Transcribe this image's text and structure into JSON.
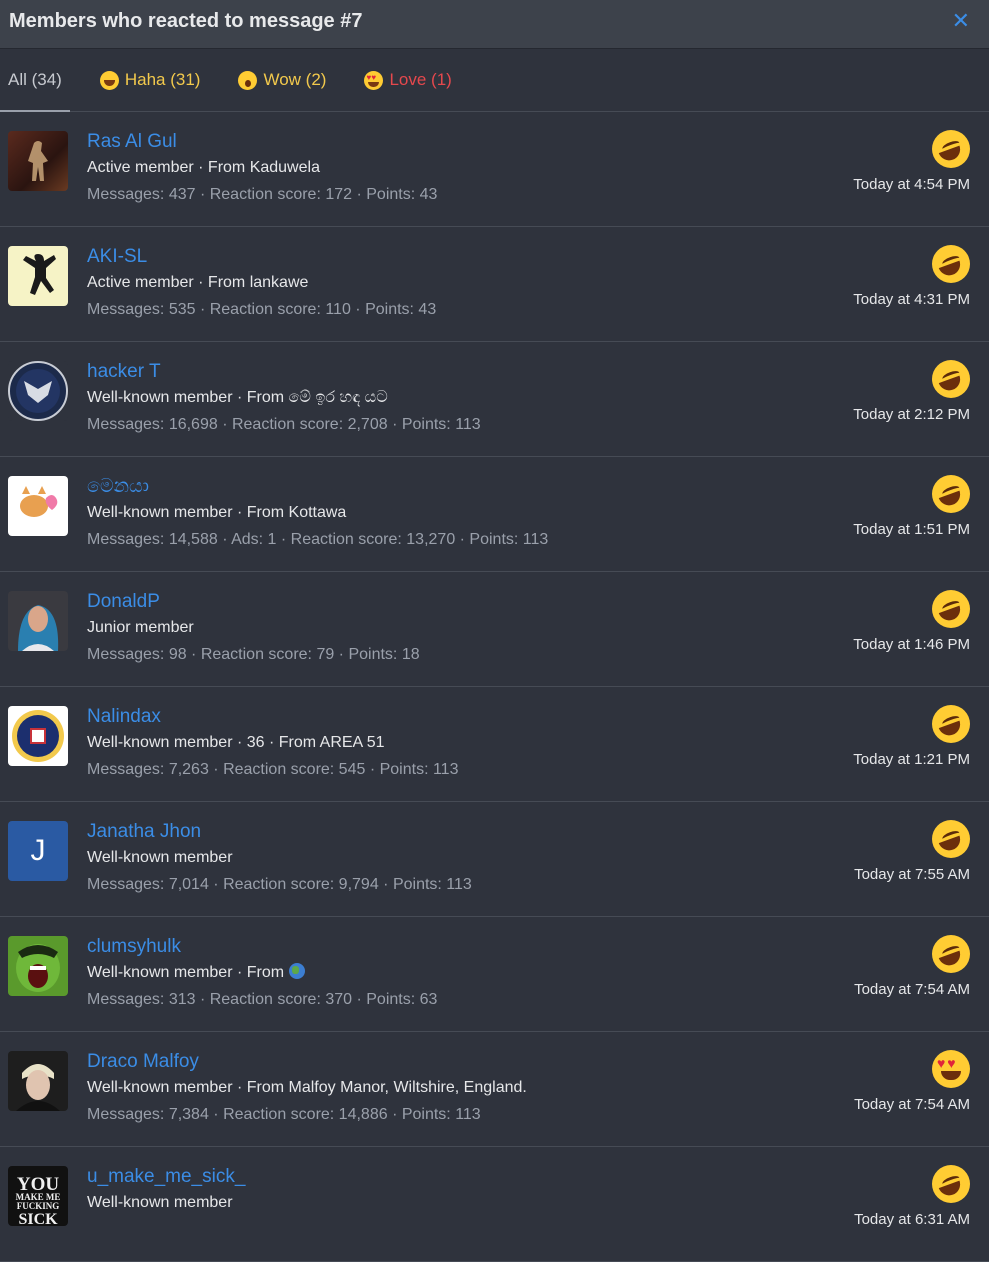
{
  "header": {
    "title": "Members who reacted to message #7",
    "close_icon": "close-icon"
  },
  "tabs": [
    {
      "label": "All (34)",
      "icon": ""
    },
    {
      "label": "Haha (31)",
      "icon": "haha-emoji-icon"
    },
    {
      "label": "Wow (2)",
      "icon": "wow-emoji-icon"
    },
    {
      "label": "Love (1)",
      "icon": "love-emoji-icon"
    }
  ],
  "members": [
    {
      "name": "Ras Al Gul",
      "line1": "Active member · From Kaduwela",
      "line2": "Messages: 437 · Reaction score: 172 · Points: 43",
      "time": "Today at 4:54 PM",
      "reaction": "haha"
    },
    {
      "name": "AKI-SL",
      "line1": "Active member · From lankawe",
      "line2": "Messages: 535 · Reaction score: 110 · Points: 43",
      "time": "Today at 4:31 PM",
      "reaction": "haha"
    },
    {
      "name": "hacker T",
      "line1": "Well-known member · From මේ ඉර හඳ යට",
      "line2": "Messages: 16,698 · Reaction score: 2,708 · Points: 113",
      "time": "Today at 2:12 PM",
      "reaction": "haha"
    },
    {
      "name": "මෙනයා",
      "line1": "Well-known member · From Kottawa",
      "line2": "Messages: 14,588 · Ads: 1 · Reaction score: 13,270 · Points: 113",
      "time": "Today at 1:51 PM",
      "reaction": "haha"
    },
    {
      "name": "DonaldP",
      "line1": "Junior member",
      "line2": "Messages: 98 · Reaction score: 79 · Points: 18",
      "time": "Today at 1:46 PM",
      "reaction": "haha"
    },
    {
      "name": "Nalindax",
      "line1": "Well-known member · 36 · From AREA 51",
      "line2": "Messages: 7,263 · Reaction score: 545 · Points: 113",
      "time": "Today at 1:21 PM",
      "reaction": "haha"
    },
    {
      "name": "Janatha Jhon",
      "line1": "Well-known member",
      "line2": "Messages: 7,014 · Reaction score: 9,794 · Points: 113",
      "time": "Today at 7:55 AM",
      "reaction": "haha",
      "avatar_letter": "J"
    },
    {
      "name": "clumsyhulk",
      "line1": "Well-known member · From",
      "line2": "Messages: 313 · Reaction score: 370 · Points: 63",
      "time": "Today at 7:54 AM",
      "reaction": "haha",
      "location_icon": "globe-icon"
    },
    {
      "name": "Draco Malfoy",
      "line1": "Well-known member · From Malfoy Manor, Wiltshire, England.",
      "line2": "Messages: 7,384 · Reaction score: 14,886 · Points: 113",
      "time": "Today at 7:54 AM",
      "reaction": "love"
    },
    {
      "name": "u_make_me_sick_",
      "line1": "Well-known member",
      "line2": "",
      "time": "Today at 6:31 AM",
      "reaction": "haha",
      "avatar_text": "YOU MAKE ME FUCKING SICK"
    }
  ],
  "colors": {
    "link": "#3b8de6",
    "background": "#2f333d",
    "header": "#3d424b",
    "haha_tab": "#f2c94c",
    "love_tab": "#e5484d"
  }
}
